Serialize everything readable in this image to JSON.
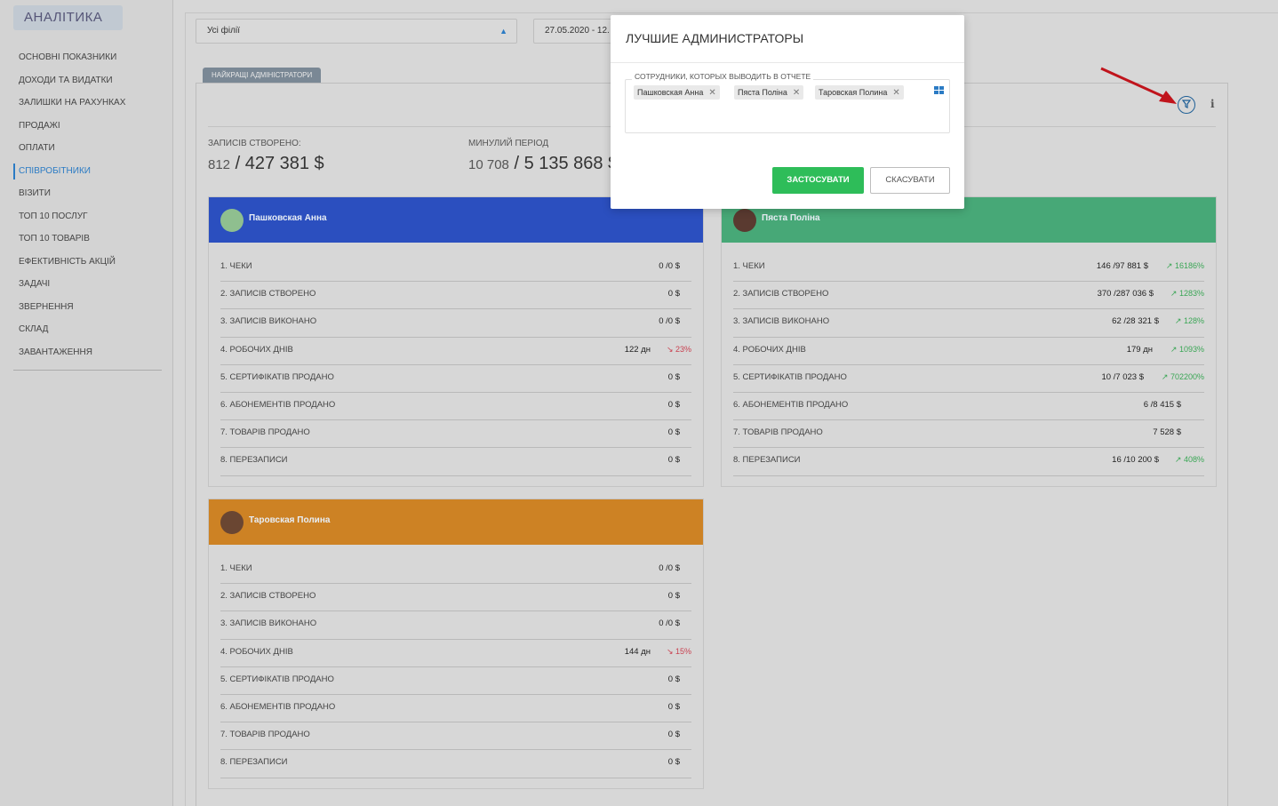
{
  "sidebar": {
    "brand": "АНАЛІТИКА",
    "items": [
      {
        "label": "ОСНОВНІ ПОКАЗНИКИ"
      },
      {
        "label": "ДОХОДИ ТА ВИДАТКИ"
      },
      {
        "label": "ЗАЛИШКИ НА РАХУНКАХ"
      },
      {
        "label": "ПРОДАЖІ"
      },
      {
        "label": "ОПЛАТИ"
      },
      {
        "label": "СПІВРОБІТНИКИ"
      },
      {
        "label": "ВІЗИТИ"
      },
      {
        "label": "ТОП 10 ПОСЛУГ"
      },
      {
        "label": "ТОП 10 ТОВАРІВ"
      },
      {
        "label": "ЕФЕКТИВНІСТЬ АКЦІЙ"
      },
      {
        "label": "ЗАДАЧІ"
      },
      {
        "label": "ЗВЕРНЕННЯ"
      },
      {
        "label": "СКЛАД"
      },
      {
        "label": "ЗАВАНТАЖЕННЯ"
      }
    ]
  },
  "filters": {
    "branch": "Усі філії",
    "date": "27.05.2020 - 12."
  },
  "tab": "НАЙКРАЩІ АДМІНІСТРАТОРИ",
  "stats": {
    "created_label": "ЗАПИСІВ СТВОРЕНО:",
    "created_count": "812",
    "created_sum": "/ 427 381 $",
    "prev_label": "МИНУЛИЙ ПЕРІОД",
    "prev_count": "10 708",
    "prev_sum": "/ 5 135 868 $"
  },
  "cards": [
    {
      "name": "Пашковская Анна",
      "color": "#2b4fbf",
      "rows": [
        {
          "label": "1. ЧЕКИ",
          "value": "0 /0 $",
          "trend": ""
        },
        {
          "label": "2. ЗАПИСІВ СТВОРЕНО",
          "value": "0 $",
          "trend": ""
        },
        {
          "label": "3. ЗАПИСІВ ВИКОНАНО",
          "value": "0 /0 $",
          "trend": ""
        },
        {
          "label": "4. РОБОЧИХ ДНІВ",
          "value": "122 дн",
          "trend": "23%"
        },
        {
          "label": "5. СЕРТИФІКАТІВ ПРОДАНО",
          "value": "0 $",
          "trend": ""
        },
        {
          "label": "6. АБОНЕМЕНТІВ ПРОДАНО",
          "value": "0 $",
          "trend": ""
        },
        {
          "label": "7. ТОВАРІВ ПРОДАНО",
          "value": "0 $",
          "trend": ""
        },
        {
          "label": "8. ПЕРЕЗАПИСИ",
          "value": "0 $",
          "trend": ""
        }
      ]
    },
    {
      "name": "Пяста Поліна",
      "color": "#47a877",
      "rows": [
        {
          "label": "1. ЧЕКИ",
          "value": "146 /97 881 $",
          "trend": "16186%"
        },
        {
          "label": "2. ЗАПИСІВ СТВОРЕНО",
          "value": "370 /287 036 $",
          "trend": "1283%"
        },
        {
          "label": "3. ЗАПИСІВ ВИКОНАНО",
          "value": "62 /28 321 $",
          "trend": "128%"
        },
        {
          "label": "4. РОБОЧИХ ДНІВ",
          "value": "179 дн",
          "trend": "1093%"
        },
        {
          "label": "5. СЕРТИФІКАТІВ ПРОДАНО",
          "value": "10 /7 023 $",
          "trend": "702200%"
        },
        {
          "label": "6. АБОНЕМЕНТІВ ПРОДАНО",
          "value": "6 /8 415 $",
          "trend": ""
        },
        {
          "label": "7. ТОВАРІВ ПРОДАНО",
          "value": "7 528 $",
          "trend": ""
        },
        {
          "label": "8. ПЕРЕЗАПИСИ",
          "value": "16 /10 200 $",
          "trend": "408%"
        }
      ]
    },
    {
      "name": "Таровская Полина",
      "color": "#cd8224",
      "rows": [
        {
          "label": "1. ЧЕКИ",
          "value": "0 /0 $",
          "trend": ""
        },
        {
          "label": "2. ЗАПИСІВ СТВОРЕНО",
          "value": "0 $",
          "trend": ""
        },
        {
          "label": "3. ЗАПИСІВ ВИКОНАНО",
          "value": "0 /0 $",
          "trend": ""
        },
        {
          "label": "4. РОБОЧИХ ДНІВ",
          "value": "144 дн",
          "trend": "15%"
        },
        {
          "label": "5. СЕРТИФІКАТІВ ПРОДАНО",
          "value": "0 $",
          "trend": ""
        },
        {
          "label": "6. АБОНЕМЕНТІВ ПРОДАНО",
          "value": "0 $",
          "trend": ""
        },
        {
          "label": "7. ТОВАРІВ ПРОДАНО",
          "value": "0 $",
          "trend": ""
        },
        {
          "label": "8. ПЕРЕЗАПИСИ",
          "value": "0 $",
          "trend": ""
        }
      ]
    }
  ],
  "modal": {
    "title": "ЛУЧШИЕ АДМИНИСТРАТОРЫ",
    "field_label": "СОТРУДНИКИ, КОТОРЫХ ВЫВОДИТЬ В ОТЧЕТЕ",
    "chips": [
      "Пашковская Анна",
      "Пяста Поліна",
      "Таровская Полина"
    ],
    "apply_label": "ЗАСТОСУВАТИ",
    "cancel_label": "СКАСУВАТИ"
  },
  "colors": {
    "accent": "#2b7bc4",
    "apply": "#2ebd59",
    "arrow": "#c0141c"
  }
}
